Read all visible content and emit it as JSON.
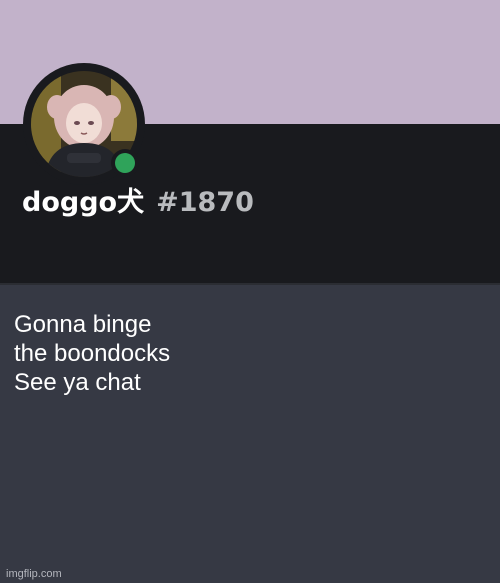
{
  "profile": {
    "username": "doggo犬",
    "discriminator": "#1870",
    "status": "online",
    "status_color": "#2fa35a",
    "banner_color": "#c2b2ca",
    "avatar": "anime-girl-avatar"
  },
  "bio": {
    "lines": [
      "Gonna binge",
      "the boondocks",
      "See ya chat"
    ]
  },
  "watermark": "imgflip.com"
}
